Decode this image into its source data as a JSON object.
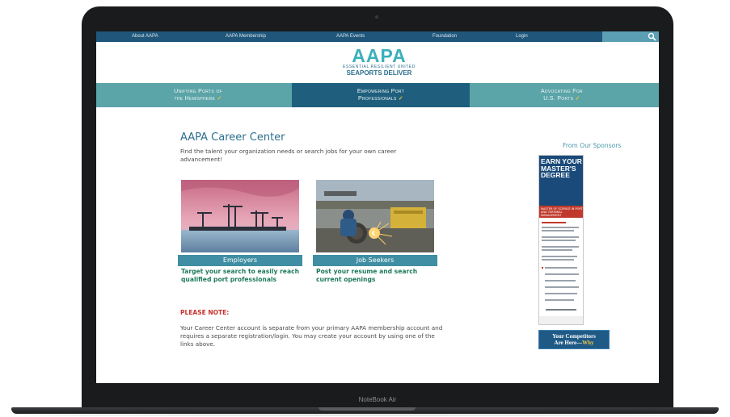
{
  "device": {
    "label": "NoteBook Air"
  },
  "topnav": {
    "items": [
      "About AAPA",
      "AAPA Membership",
      "AAPA Events",
      "Foundation",
      "Login"
    ],
    "search_icon": "search-icon"
  },
  "logo": {
    "main": "AAPA",
    "sub": "ESSENTIAL RESILIENT UNITED",
    "tag": "SEAPORTS DELIVER"
  },
  "section_nav": {
    "items": [
      {
        "line1": "Unifying Ports of",
        "line2": "the Hemisphere"
      },
      {
        "line1": "Empowering Port",
        "line2": "Professionals"
      },
      {
        "line1": "Advocating For",
        "line2": "U.S. Ports"
      }
    ]
  },
  "content": {
    "title": "AAPA Career Center",
    "intro": "Find the talent your organization needs or search jobs for your own career advancement!",
    "cards": [
      {
        "tab": "Employers",
        "cta": "Target your search to easily reach qualified port professionals"
      },
      {
        "tab": "Job Seekers",
        "cta": "Post your resume and search current openings"
      }
    ],
    "note_head": "PLEASE NOTE:",
    "note_body": "Your Career Center account is separate from your primary AAPA membership account and requires a separate registration/login. You may create your account by using one of the links above."
  },
  "sidebar": {
    "sponsors_label": "From Our Sponsors",
    "ad1": {
      "line1": "EARN YOUR",
      "line2": "MASTER'S",
      "line3": "DEGREE",
      "small": "MASTER OF SCIENCE IN PORT AND TERMINAL MANAGEMENT"
    },
    "ad2": {
      "line1": "Your Competitors",
      "line2": "Are Here—",
      "why": "Why"
    }
  },
  "colors": {
    "topnav": "#20567a",
    "secnav": "#5ba4a8",
    "secnav_active": "#1f5f7d",
    "accent": "#f2c53d",
    "title": "#2c6f8e"
  }
}
